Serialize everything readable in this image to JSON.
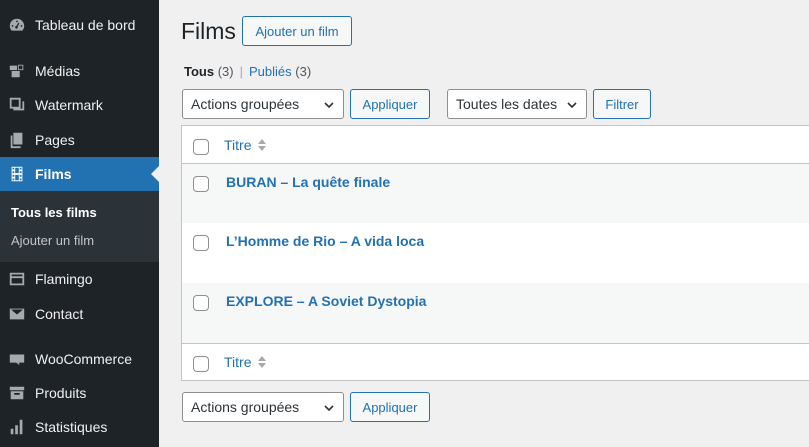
{
  "sidebar": {
    "items": [
      {
        "label": "Tableau de bord",
        "icon": "dashboard-icon"
      },
      {
        "label": "Médias",
        "icon": "media-icon"
      },
      {
        "label": "Watermark",
        "icon": "watermark-icon"
      },
      {
        "label": "Pages",
        "icon": "pages-icon"
      },
      {
        "label": "Films",
        "icon": "film-icon",
        "active": true
      },
      {
        "label": "Flamingo",
        "icon": "flamingo-icon"
      },
      {
        "label": "Contact",
        "icon": "mail-icon"
      },
      {
        "label": "WooCommerce",
        "icon": "woocommerce-icon"
      },
      {
        "label": "Produits",
        "icon": "archive-icon"
      },
      {
        "label": "Statistiques",
        "icon": "chart-bar-icon"
      }
    ],
    "submenu": [
      {
        "label": "Tous les films",
        "current": true
      },
      {
        "label": "Ajouter un film"
      }
    ]
  },
  "header": {
    "title": "Films",
    "add_button": "Ajouter un film"
  },
  "views": {
    "all_label": "Tous",
    "all_count": "(3)",
    "separator": "|",
    "published_label": "Publiés",
    "published_count": "(3)"
  },
  "top_nav": {
    "bulk_actions": "Actions groupées",
    "apply": "Appliquer",
    "dates": "Toutes les dates",
    "filter": "Filtrer"
  },
  "table": {
    "column_title": "Titre",
    "rows": [
      {
        "title": "BURAN – La quête finale"
      },
      {
        "title": "L’Homme de Rio – A vida loca"
      },
      {
        "title": "EXPLORE – A Soviet Dystopia"
      }
    ]
  },
  "bottom_nav": {
    "bulk_actions": "Actions groupées",
    "apply": "Appliquer"
  },
  "colors": {
    "sidebar_bg": "#1d2327",
    "accent": "#2271b1",
    "page_bg": "#f0f0f1"
  }
}
